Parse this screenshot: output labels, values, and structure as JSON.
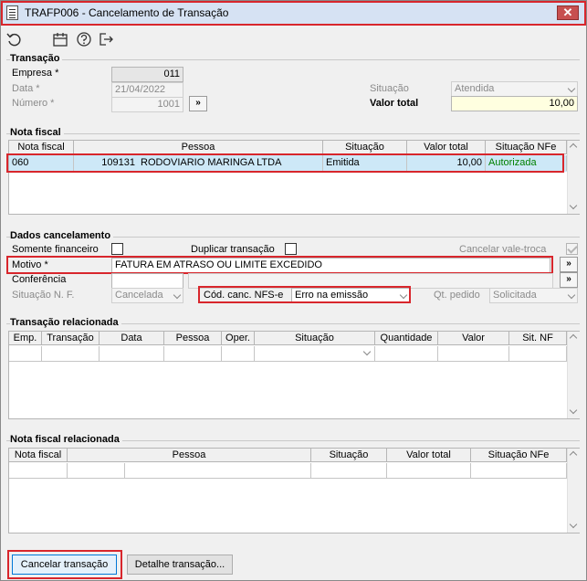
{
  "window": {
    "title": "TRAFP006 - Cancelamento de Transação",
    "close": "✕"
  },
  "toolbar": {
    "icons": [
      "refresh-icon",
      "calendar-icon",
      "help-icon",
      "exit-icon"
    ]
  },
  "transacao": {
    "section": "Transação",
    "empresa_label": "Empresa *",
    "empresa_value": "011",
    "data_label": "Data *",
    "data_value": "21/04/2022",
    "numero_label": "Número *",
    "numero_value": "1001",
    "more": "»",
    "situacao_label": "Situação",
    "situacao_value": "Atendida",
    "valor_total_label": "Valor total",
    "valor_total_value": "10,00"
  },
  "nota_fiscal": {
    "section": "Nota fiscal",
    "columns": [
      "Nota fiscal",
      "Pessoa",
      "Situação",
      "Valor total",
      "Situação NFe"
    ],
    "row": {
      "nota": "060",
      "codigo": "109131",
      "pessoa": "RODOVIARIO MARINGA LTDA",
      "situacao": "Emitida",
      "valor": "10,00",
      "situacao_nfe": "Autorizada"
    }
  },
  "dados": {
    "section": "Dados cancelamento",
    "somente_financeiro": "Somente financeiro",
    "duplicar_transacao": "Duplicar transação",
    "cancelar_vale_troca": "Cancelar vale-troca",
    "motivo_label": "Motivo *",
    "motivo_value": "FATURA EM ATRASO OU LIMITE EXCEDIDO",
    "conferencia_label": "Conferência",
    "situacao_nf_label": "Situação N. F.",
    "situacao_nf_value": "Cancelada",
    "cod_canc_label": "Cód. canc. NFS-e",
    "cod_canc_value": "Erro na emissão",
    "qt_pedido_label": "Qt. pedido",
    "qt_pedido_value": "Solicitada",
    "more": "»"
  },
  "transacao_relacionada": {
    "section": "Transação relacionada",
    "columns": [
      "Emp.",
      "Transação",
      "Data",
      "Pessoa",
      "Oper.",
      "Situação",
      "Quantidade",
      "Valor",
      "Sit. NF"
    ]
  },
  "nf_relacionada": {
    "section": "Nota fiscal relacionada",
    "columns": [
      "Nota fiscal",
      "Pessoa",
      "Situação",
      "Valor total",
      "Situação NFe"
    ]
  },
  "footer": {
    "cancelar": "Cancelar transação",
    "detalhe": "Detalhe transação..."
  },
  "colors": {
    "highlight": "#d8262c",
    "selected_row": "#cde8f7",
    "authorized": "#008000"
  }
}
